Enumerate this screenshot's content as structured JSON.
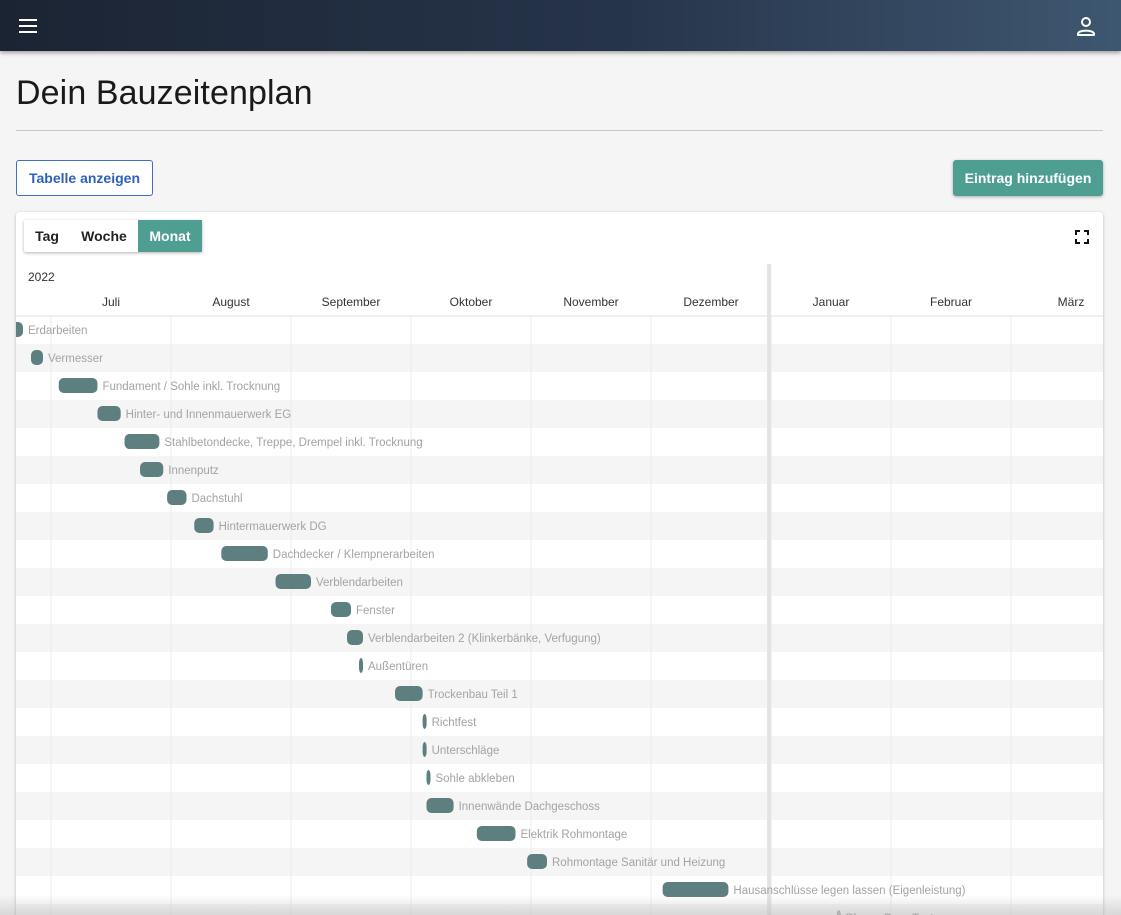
{
  "header": {
    "menu_icon": "menu-icon",
    "account_icon": "account-icon"
  },
  "page": {
    "title": "Dein Bauzeitenplan"
  },
  "actions": {
    "table_label": "Tabelle anzeigen",
    "add_label": "Eintrag hinzufügen"
  },
  "view_modes": [
    {
      "label": "Tag",
      "active": false
    },
    {
      "label": "Woche",
      "active": false
    },
    {
      "label": "Monat",
      "active": true
    }
  ],
  "fullscreen_icon": "fullscreen-icon",
  "colors": {
    "accent": "#4e9e92",
    "bar": "#5d7f80",
    "link": "#2f5fb8"
  },
  "chart_data": {
    "type": "gantt",
    "year_label": "2022",
    "months": [
      "Juli",
      "August",
      "September",
      "Oktober",
      "November",
      "Dezember",
      "Januar",
      "Februar",
      "März"
    ],
    "today_marker": "2022-12-31",
    "tasks": [
      {
        "name": "Erdarbeiten",
        "start": "2022-06-19",
        "end": "2022-06-24"
      },
      {
        "name": "Vermesser",
        "start": "2022-06-26",
        "end": "2022-06-29"
      },
      {
        "name": "Fundament / Sohle inkl. Trocknung",
        "start": "2022-07-03",
        "end": "2022-07-13"
      },
      {
        "name": "Hinter- und Innenmauerwerk EG",
        "start": "2022-07-13",
        "end": "2022-07-19"
      },
      {
        "name": "Stahlbetondecke, Treppe, Drempel inkl. Trocknung",
        "start": "2022-07-20",
        "end": "2022-07-29"
      },
      {
        "name": "Innenputz",
        "start": "2022-07-24",
        "end": "2022-07-30"
      },
      {
        "name": "Dachstuhl",
        "start": "2022-07-31",
        "end": "2022-08-05"
      },
      {
        "name": "Hintermauerwerk DG",
        "start": "2022-08-07",
        "end": "2022-08-12"
      },
      {
        "name": "Dachdecker / Klempnerarbeiten",
        "start": "2022-08-14",
        "end": "2022-08-26"
      },
      {
        "name": "Verblendarbeiten",
        "start": "2022-08-28",
        "end": "2022-09-06"
      },
      {
        "name": "Fenster",
        "start": "2022-09-11",
        "end": "2022-09-16"
      },
      {
        "name": "Verblendarbeiten 2 (Klinkerbänke, Verfugung)",
        "start": "2022-09-15",
        "end": "2022-09-19"
      },
      {
        "name": "Außentüren",
        "start": "2022-09-18",
        "end": "2022-09-19"
      },
      {
        "name": "Trockenbau Teil 1",
        "start": "2022-09-27",
        "end": "2022-10-04"
      },
      {
        "name": "Richtfest",
        "start": "2022-10-04",
        "end": "2022-10-05"
      },
      {
        "name": "Unterschläge",
        "start": "2022-10-04",
        "end": "2022-10-05"
      },
      {
        "name": "Sohle abkleben",
        "start": "2022-10-05",
        "end": "2022-10-06"
      },
      {
        "name": "Innenwände Dachgeschoss",
        "start": "2022-10-05",
        "end": "2022-10-12"
      },
      {
        "name": "Elektrik Rohmontage",
        "start": "2022-10-18",
        "end": "2022-10-28"
      },
      {
        "name": "Rohmontage Sanitär und Heizung",
        "start": "2022-10-31",
        "end": "2022-11-05"
      },
      {
        "name": "Hausanschlüsse legen lassen (Eigenleistung)",
        "start": "2022-12-04",
        "end": "2022-12-21"
      },
      {
        "name": "Blower Door Test",
        "start": "2023-01-18",
        "end": "2023-01-19"
      }
    ]
  }
}
